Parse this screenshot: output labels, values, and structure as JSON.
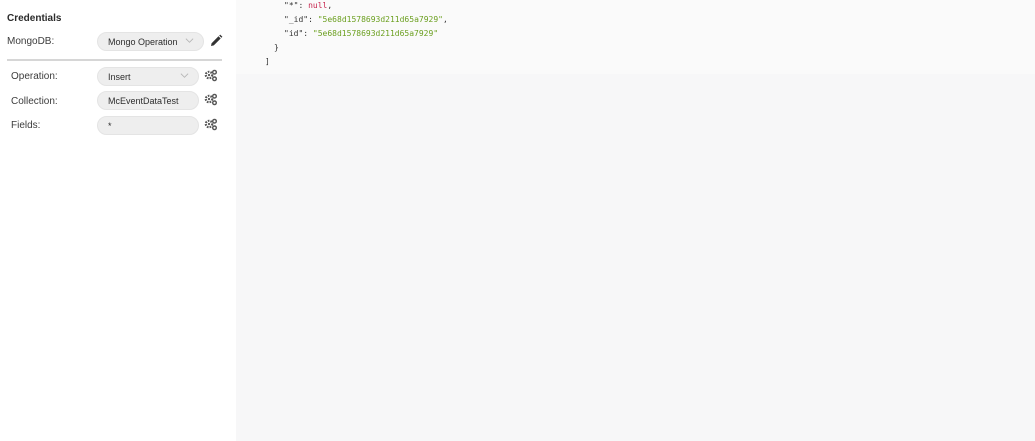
{
  "credentials": {
    "title": "Credentials",
    "mongodb_label": "MongoDB:",
    "mongodb_value": "Mongo Operation"
  },
  "parameters": {
    "operation_label": "Operation:",
    "operation_value": "Insert",
    "collection_label": "Collection:",
    "collection_value": "McEventDataTest",
    "fields_label": "Fields:",
    "fields_value": "*"
  },
  "output": {
    "line1_key": "\"*\"",
    "line1_sep": ": ",
    "line1_val": "null",
    "line1_end": ",",
    "line2_key": "\"_id\"",
    "line2_sep": ": ",
    "line2_val": "\"5e68d1578693d211d65a7929\"",
    "line2_end": ",",
    "line3_key": "\"id\"",
    "line3_sep": ": ",
    "line3_val": "\"5e68d1578693d211d65a7929\"",
    "brace_close": "}",
    "bracket_close": "]"
  },
  "icons": {
    "edit": "pencil-icon",
    "parameter_options": "gears-icon",
    "dropdown": "chevron-down-icon"
  }
}
